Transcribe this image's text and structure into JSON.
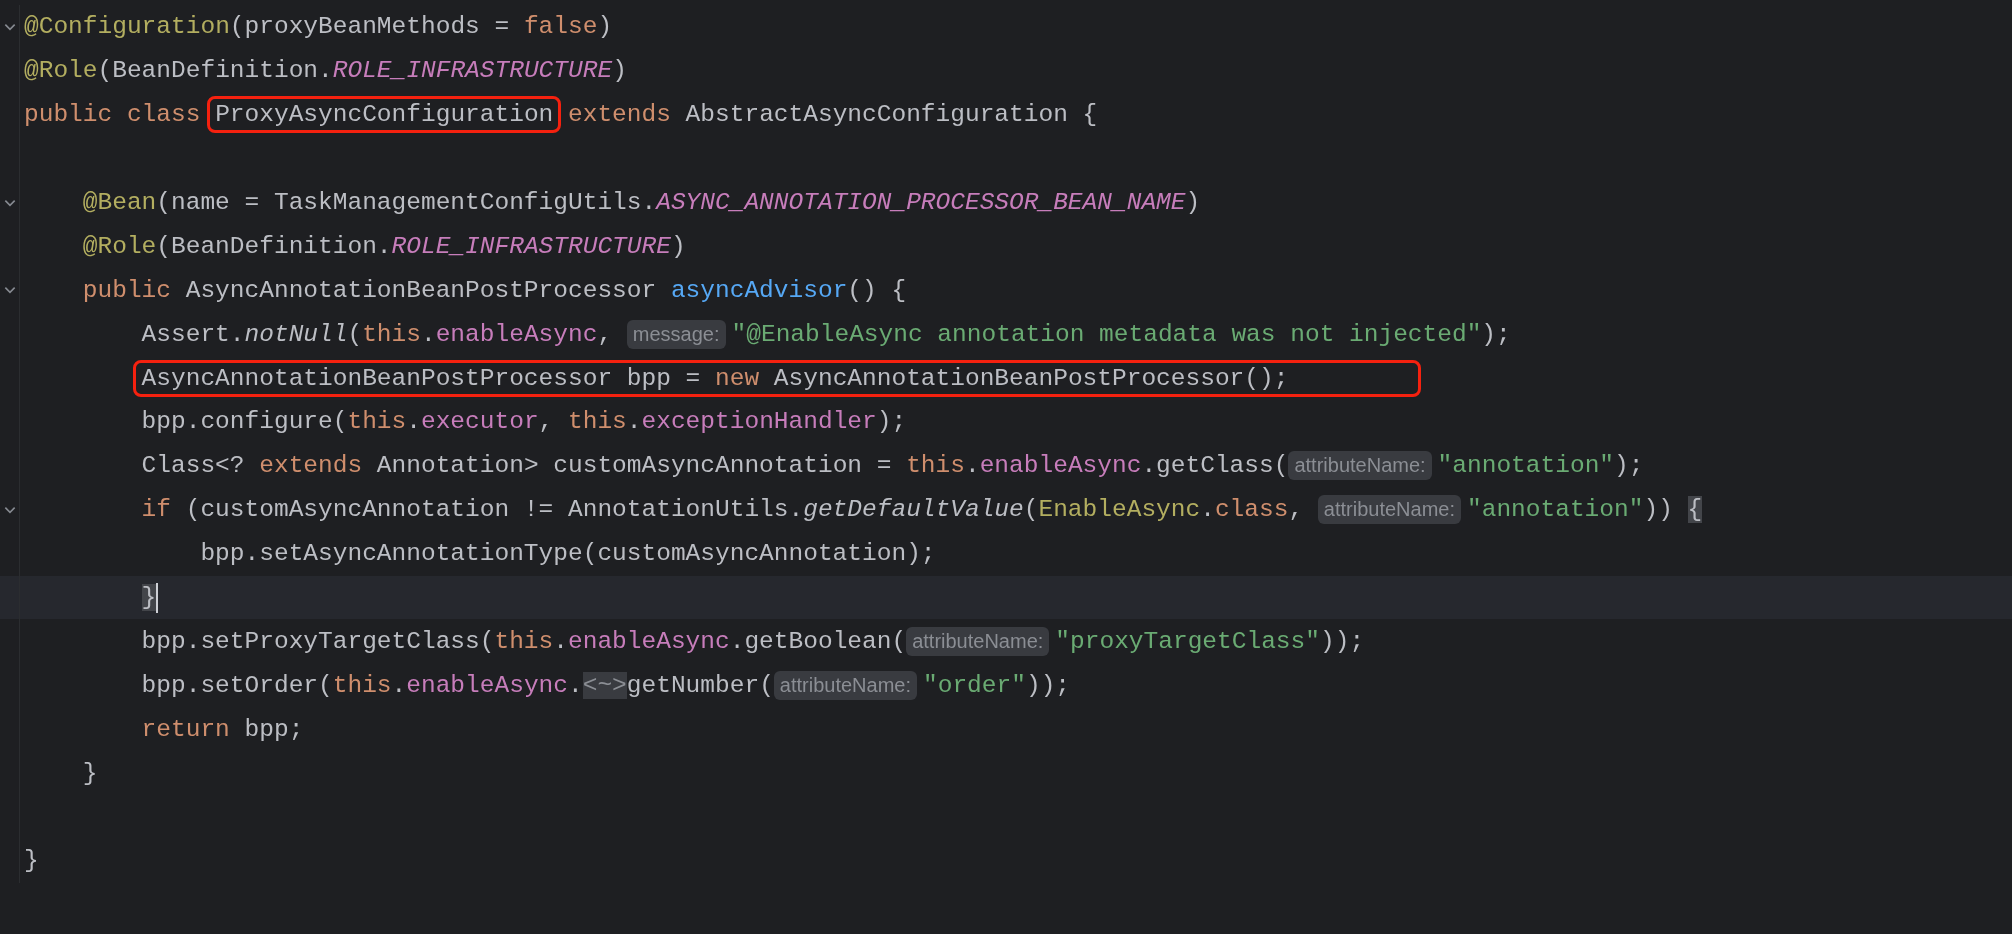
{
  "lines": [
    {
      "fold": true,
      "current": false,
      "boxed": false,
      "tokens": [
        {
          "kind": "ann",
          "text": "@Configuration"
        },
        {
          "kind": "p",
          "text": "(proxyBeanMethods = "
        },
        {
          "kind": "kw",
          "text": "false"
        },
        {
          "kind": "p",
          "text": ")"
        }
      ]
    },
    {
      "fold": false,
      "current": false,
      "boxed": false,
      "tokens": [
        {
          "kind": "ann",
          "text": "@Role"
        },
        {
          "kind": "p",
          "text": "(BeanDefinition."
        },
        {
          "kind": "cst",
          "text": "ROLE_INFRASTRUCTURE"
        },
        {
          "kind": "p",
          "text": ")"
        }
      ]
    },
    {
      "fold": false,
      "current": false,
      "boxed": false,
      "tokens": [
        {
          "kind": "kw",
          "text": "public class "
        },
        {
          "kind": "p",
          "text": "ProxyAsyncConfiguration",
          "boxed": true
        },
        {
          "kind": "kw",
          "text": " extends"
        },
        {
          "kind": "p",
          "text": " AbstractAsyncConfiguration {"
        }
      ],
      "children": [
        {
          "fold": false,
          "current": false,
          "boxed": false
        },
        {
          "fold": true,
          "current": false,
          "boxed": false,
          "tokens": [
            {
              "kind": "ann",
              "text": "@Bean"
            },
            {
              "kind": "p",
              "text": "(name = TaskManagementConfigUtils."
            },
            {
              "kind": "cst",
              "text": "ASYNC_ANNOTATION_PROCESSOR_BEAN_NAME"
            },
            {
              "kind": "p",
              "text": ")"
            }
          ]
        },
        {
          "fold": false,
          "current": false,
          "boxed": false,
          "tokens": [
            {
              "kind": "ann",
              "text": "@Role"
            },
            {
              "kind": "p",
              "text": "(BeanDefinition."
            },
            {
              "kind": "cst",
              "text": "ROLE_INFRASTRUCTURE"
            },
            {
              "kind": "p",
              "text": ")"
            }
          ]
        },
        {
          "fold": true,
          "current": false,
          "boxed": false,
          "tokens": [
            {
              "kind": "kw",
              "text": "public "
            },
            {
              "kind": "p",
              "text": "AsyncAnnotationBeanPostProcessor "
            },
            {
              "kind": "fn",
              "text": "asyncAdvisor"
            },
            {
              "kind": "p",
              "text": "() {"
            }
          ],
          "children": [
            {
              "fold": false,
              "current": false,
              "boxed": false,
              "tokens": [
                {
                  "kind": "p",
                  "text": "Assert."
                },
                {
                  "kind": "it",
                  "text": "notNull"
                },
                {
                  "kind": "p",
                  "text": "("
                },
                {
                  "kind": "kw",
                  "text": "this"
                },
                {
                  "kind": "p",
                  "text": "."
                },
                {
                  "kind": "fld",
                  "text": "enableAsync"
                },
                {
                  "kind": "p",
                  "text": ", "
                },
                {
                  "kind": "hint",
                  "text": "message:"
                },
                {
                  "kind": "str",
                  "text": "\"@EnableAsync annotation metadata was not injected\""
                },
                {
                  "kind": "p",
                  "text": ");"
                }
              ]
            },
            {
              "fold": false,
              "current": false,
              "boxed": true,
              "tokens": [
                {
                  "kind": "p",
                  "text": "AsyncAnnotationBeanPostProcessor bpp = "
                },
                {
                  "kind": "kw",
                  "text": "new"
                },
                {
                  "kind": "p",
                  "text": " AsyncAnnotationBeanPostProcessor();"
                }
              ]
            },
            {
              "fold": false,
              "current": false,
              "boxed": false,
              "tokens": [
                {
                  "kind": "p",
                  "text": "bpp.configure("
                },
                {
                  "kind": "kw",
                  "text": "this"
                },
                {
                  "kind": "p",
                  "text": "."
                },
                {
                  "kind": "fld",
                  "text": "executor"
                },
                {
                  "kind": "p",
                  "text": ", "
                },
                {
                  "kind": "kw",
                  "text": "this"
                },
                {
                  "kind": "p",
                  "text": "."
                },
                {
                  "kind": "fld",
                  "text": "exceptionHandler"
                },
                {
                  "kind": "p",
                  "text": ");"
                }
              ]
            },
            {
              "fold": false,
              "current": false,
              "boxed": false,
              "tokens": [
                {
                  "kind": "p",
                  "text": "Class<? "
                },
                {
                  "kind": "kw",
                  "text": "extends"
                },
                {
                  "kind": "p",
                  "text": " Annotation> customAsyncAnnotation = "
                },
                {
                  "kind": "kw",
                  "text": "this"
                },
                {
                  "kind": "p",
                  "text": "."
                },
                {
                  "kind": "fld",
                  "text": "enableAsync"
                },
                {
                  "kind": "p",
                  "text": ".getClass("
                },
                {
                  "kind": "hint",
                  "text": "attributeName:"
                },
                {
                  "kind": "str",
                  "text": "\"annotation\""
                },
                {
                  "kind": "p",
                  "text": ");"
                }
              ]
            },
            {
              "fold": true,
              "current": false,
              "boxed": false,
              "tokens": [
                {
                  "kind": "kw",
                  "text": "if"
                },
                {
                  "kind": "p",
                  "text": " (customAsyncAnnotation != AnnotationUtils."
                },
                {
                  "kind": "it",
                  "text": "getDefaultValue"
                },
                {
                  "kind": "p",
                  "text": "("
                },
                {
                  "kind": "cls",
                  "text": "EnableAsync"
                },
                {
                  "kind": "p",
                  "text": "."
                },
                {
                  "kind": "kw",
                  "text": "class"
                },
                {
                  "kind": "p",
                  "text": ", "
                },
                {
                  "kind": "hint",
                  "text": "attributeName:"
                },
                {
                  "kind": "str",
                  "text": "\"annotation\""
                },
                {
                  "kind": "p",
                  "text": ")) "
                },
                {
                  "kind": "brace",
                  "text": "{"
                }
              ],
              "children": [
                {
                  "fold": false,
                  "current": false,
                  "boxed": false,
                  "tokens": [
                    {
                      "kind": "p",
                      "text": "bpp.setAsyncAnnotationType(customAsyncAnnotation);"
                    }
                  ]
                }
              ]
            },
            {
              "fold": false,
              "current": true,
              "boxed": false,
              "tokens": [
                {
                  "kind": "brace",
                  "text": "}"
                }
              ]
            },
            {
              "fold": false,
              "current": false,
              "boxed": false,
              "tokens": [
                {
                  "kind": "p",
                  "text": "bpp.setProxyTargetClass("
                },
                {
                  "kind": "kw",
                  "text": "this"
                },
                {
                  "kind": "p",
                  "text": "."
                },
                {
                  "kind": "fld",
                  "text": "enableAsync"
                },
                {
                  "kind": "p",
                  "text": ".getBoolean("
                },
                {
                  "kind": "hint",
                  "text": "attributeName:"
                },
                {
                  "kind": "str",
                  "text": "\"proxyTargetClass\""
                },
                {
                  "kind": "p",
                  "text": "));"
                }
              ]
            },
            {
              "fold": false,
              "current": false,
              "boxed": false,
              "tokens": [
                {
                  "kind": "p",
                  "text": "bpp.setOrder("
                },
                {
                  "kind": "kw",
                  "text": "this"
                },
                {
                  "kind": "p",
                  "text": "."
                },
                {
                  "kind": "fld",
                  "text": "enableAsync"
                },
                {
                  "kind": "p",
                  "text": "."
                },
                {
                  "kind": "folded",
                  "text": "<~>"
                },
                {
                  "kind": "p",
                  "text": "getNumber("
                },
                {
                  "kind": "hint",
                  "text": "attributeName:"
                },
                {
                  "kind": "str",
                  "text": "\"order\""
                },
                {
                  "kind": "p",
                  "text": "));"
                }
              ]
            },
            {
              "fold": false,
              "current": false,
              "boxed": false,
              "tokens": [
                {
                  "kind": "kw",
                  "text": "return"
                },
                {
                  "kind": "p",
                  "text": " bpp;"
                }
              ]
            }
          ]
        },
        {
          "fold": false,
          "current": false,
          "boxed": false,
          "tokens": [
            {
              "kind": "p",
              "text": "}"
            }
          ]
        },
        {
          "fold": false,
          "current": false,
          "boxed": false
        }
      ]
    },
    {
      "fold": false,
      "current": false,
      "boxed": false,
      "tokens": [
        {
          "kind": "p",
          "text": "}"
        }
      ]
    }
  ]
}
